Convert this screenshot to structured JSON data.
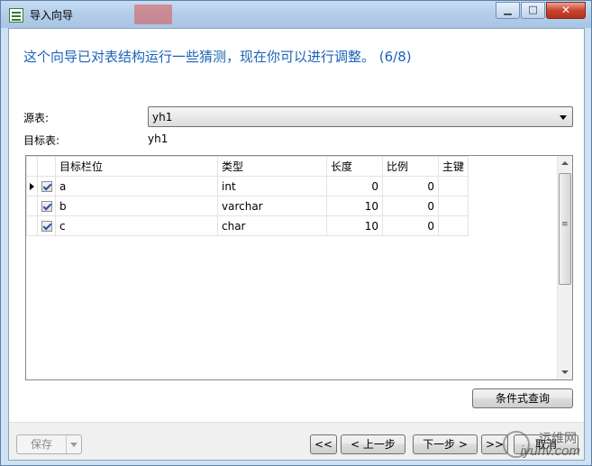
{
  "window": {
    "title": "导入向导"
  },
  "heading": "这个向导已对表结构运行一些猜测，现在你可以进行调整。 (6/8)",
  "source_table": {
    "label": "源表:",
    "value": "yh1"
  },
  "target_table": {
    "label": "目标表:",
    "value": "yh1"
  },
  "grid": {
    "columns": [
      "目标栏位",
      "类型",
      "长度",
      "比例",
      "主键"
    ],
    "rows": [
      {
        "checked": true,
        "name": "a",
        "type": "int",
        "length": "0",
        "scale": "0"
      },
      {
        "checked": true,
        "name": "b",
        "type": "varchar",
        "length": "10",
        "scale": "0"
      },
      {
        "checked": true,
        "name": "c",
        "type": "char",
        "length": "10",
        "scale": "0"
      }
    ]
  },
  "buttons": {
    "condition_query": "条件式查询",
    "save": "保存",
    "first": "<<",
    "prev": "< 上一步",
    "next": "下一步 >",
    "last": ">>",
    "cancel": "取消"
  },
  "watermark": {
    "top": "运维网",
    "bottom": "iyunv.com"
  }
}
